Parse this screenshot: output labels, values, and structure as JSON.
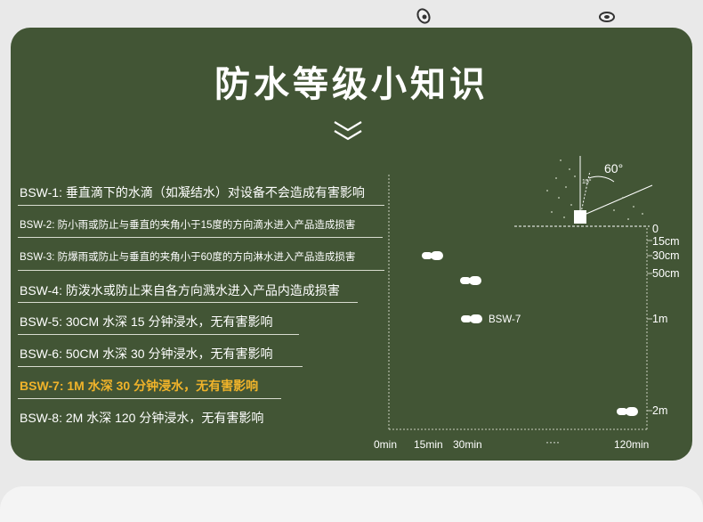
{
  "title": "防水等级小知识",
  "ratings": [
    {
      "text": "BSW-1: 垂直滴下的水滴（如凝结水）对设备不会造成有害影响",
      "size": "big",
      "highlight": false
    },
    {
      "text": "BSW-2: 防小雨或防止与垂直的夹角小于15度的方向滴水进入产品造成损害",
      "size": "small",
      "highlight": false
    },
    {
      "text": "BSW-3: 防爆雨或防止与垂直的夹角小于60度的方向淋水进入产品造成损害",
      "size": "small",
      "highlight": false
    },
    {
      "text": "BSW-4: 防泼水或防止来自各方向溅水进入产品内造成损害",
      "size": "big",
      "highlight": false
    },
    {
      "text": "BSW-5: 30CM 水深 15 分钟浸水，无有害影响",
      "size": "big",
      "highlight": false
    },
    {
      "text": "BSW-6: 50CM 水深 30 分钟浸水，无有害影响",
      "size": "big",
      "highlight": false
    },
    {
      "text": "BSW-7: 1M 水深 30 分钟浸水，无有害影响",
      "size": "big",
      "highlight": true
    },
    {
      "text": "BSW-8: 2M 水深 120 分钟浸水，无有害影响",
      "size": "big",
      "highlight": false
    }
  ],
  "diagram": {
    "angle_60": "60°",
    "angle_15": "15°",
    "marker_label": "BSW-7",
    "x_ticks": [
      "0min",
      "15min",
      "30min",
      "····",
      "120min"
    ],
    "y_ticks": [
      "0",
      "15cm",
      "30cm",
      "50cm",
      "1m",
      "2m"
    ]
  },
  "colors": {
    "card": "#425535",
    "highlight": "#f0b32a",
    "text": "#ffffff"
  }
}
